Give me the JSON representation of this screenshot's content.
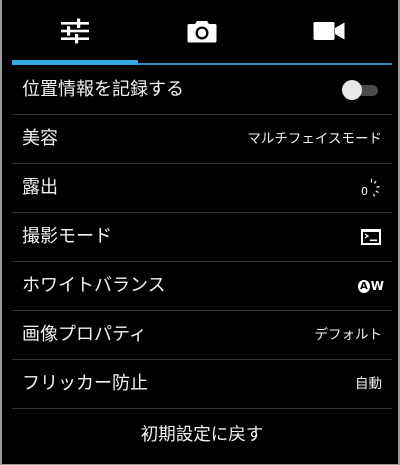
{
  "tabs": [
    {
      "icon": "sliders-icon",
      "active": true
    },
    {
      "icon": "camera-icon",
      "active": false
    },
    {
      "icon": "video-camera-icon",
      "active": false
    }
  ],
  "colors": {
    "accent": "#36a7e2",
    "background": "#000000",
    "divider": "#333333",
    "text": "#f2f2f2"
  },
  "settings": {
    "location": {
      "label": "位置情報を記録する",
      "enabled": false
    },
    "beauty": {
      "label": "美容",
      "value": "マルチフェイスモード"
    },
    "exposure": {
      "label": "露出",
      "icon": "exposure-zero-icon",
      "value_text": "0"
    },
    "scene_mode": {
      "label": "撮影モード",
      "icon": "scene-auto-icon"
    },
    "white_balance": {
      "label": "ホワイトバランス",
      "icon": "awb-icon",
      "value_text": "A",
      "value_suffix": "W"
    },
    "picture_props": {
      "label": "画像プロパティ",
      "value": "デフォルト"
    },
    "anti_flicker": {
      "label": "フリッカー防止",
      "value": "自動"
    }
  },
  "reset_label": "初期設定に戻す"
}
